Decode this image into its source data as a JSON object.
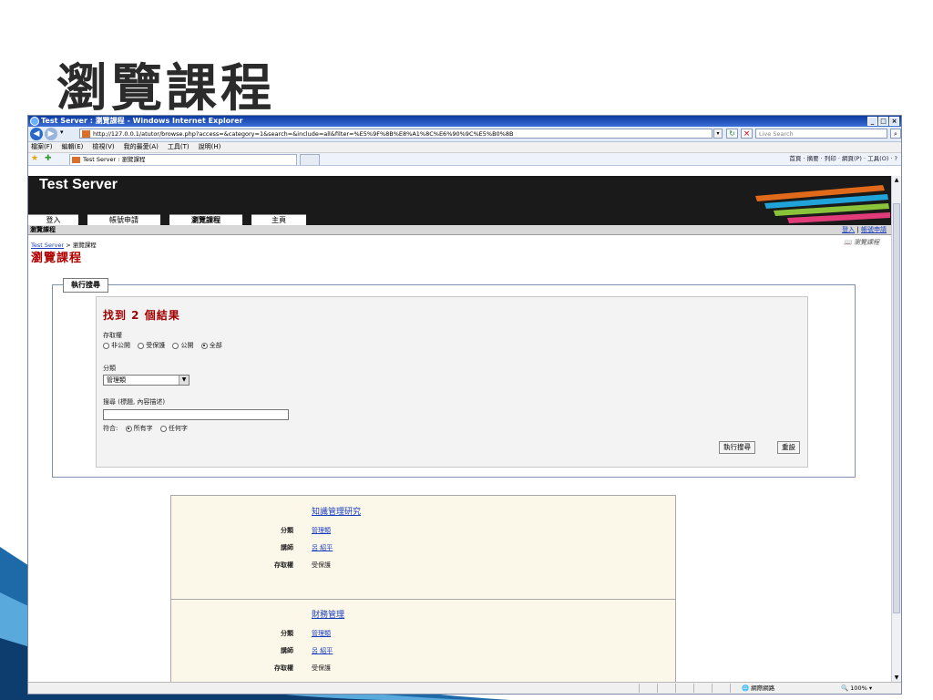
{
  "slide": {
    "title": "瀏覽課程"
  },
  "window": {
    "title": "Test Server : 瀏覽課程 - Windows Internet Explorer",
    "minimize": "_",
    "maximize": "□",
    "close": "×"
  },
  "address": {
    "url": "http://127.0.0.1/atutor/browse.php?access=&category=1&search=&include=all&filter=%E5%9F%8B%E8%A1%8C%E6%90%9C%E5%B0%8B",
    "live_search_placeholder": "Live Search"
  },
  "menu": [
    "檔案(F)",
    "編輯(E)",
    "檢視(V)",
    "我的最愛(A)",
    "工具(T)",
    "說明(H)"
  ],
  "tab": {
    "label": "Test Server : 瀏覽課程"
  },
  "command_bar": "首頁 · 摘要 · 列印 · 網頁(P) · 工具(O) · ?",
  "site": {
    "name": "Test Server",
    "nav": [
      "登入",
      "帳號申請",
      "瀏覽課程",
      "主頁"
    ],
    "section": "瀏覽課程",
    "login_link": "登入",
    "separator": "|",
    "register_link": "帳號申請"
  },
  "breadcrumb": {
    "home": "Test Server",
    "sep": " > ",
    "current": "瀏覽課程"
  },
  "page": {
    "heading": "瀏覽課程",
    "browse_link": "瀏覽課程"
  },
  "search_form": {
    "legend": "執行搜尋",
    "result_text": "找到 2 個結果",
    "access_label": "存取權",
    "access_options": [
      "非公開",
      "受保護",
      "公開",
      "全部"
    ],
    "access_selected": "全部",
    "category_label": "分類",
    "category_value": "管理類",
    "search_label": "搜尋 (標題, 內容描述)",
    "search_value": "",
    "match_label": "符合:",
    "match_options": [
      "所有字",
      "任何字"
    ],
    "match_selected": "所有字",
    "submit_label": "執行搜尋",
    "reset_label": "重設"
  },
  "results": [
    {
      "title": "知識管理研究",
      "category_label": "分類",
      "category": "管理類",
      "instructor_label": "講師",
      "instructor": "呂 紹平",
      "access_label": "存取權",
      "access": "受保護"
    },
    {
      "title": "財務管理",
      "category_label": "分類",
      "category": "管理類",
      "instructor_label": "講師",
      "instructor": "呂 紹平",
      "access_label": "存取權",
      "access": "受保護"
    }
  ],
  "status": {
    "zone": "網際網路",
    "zoom": "100%"
  }
}
